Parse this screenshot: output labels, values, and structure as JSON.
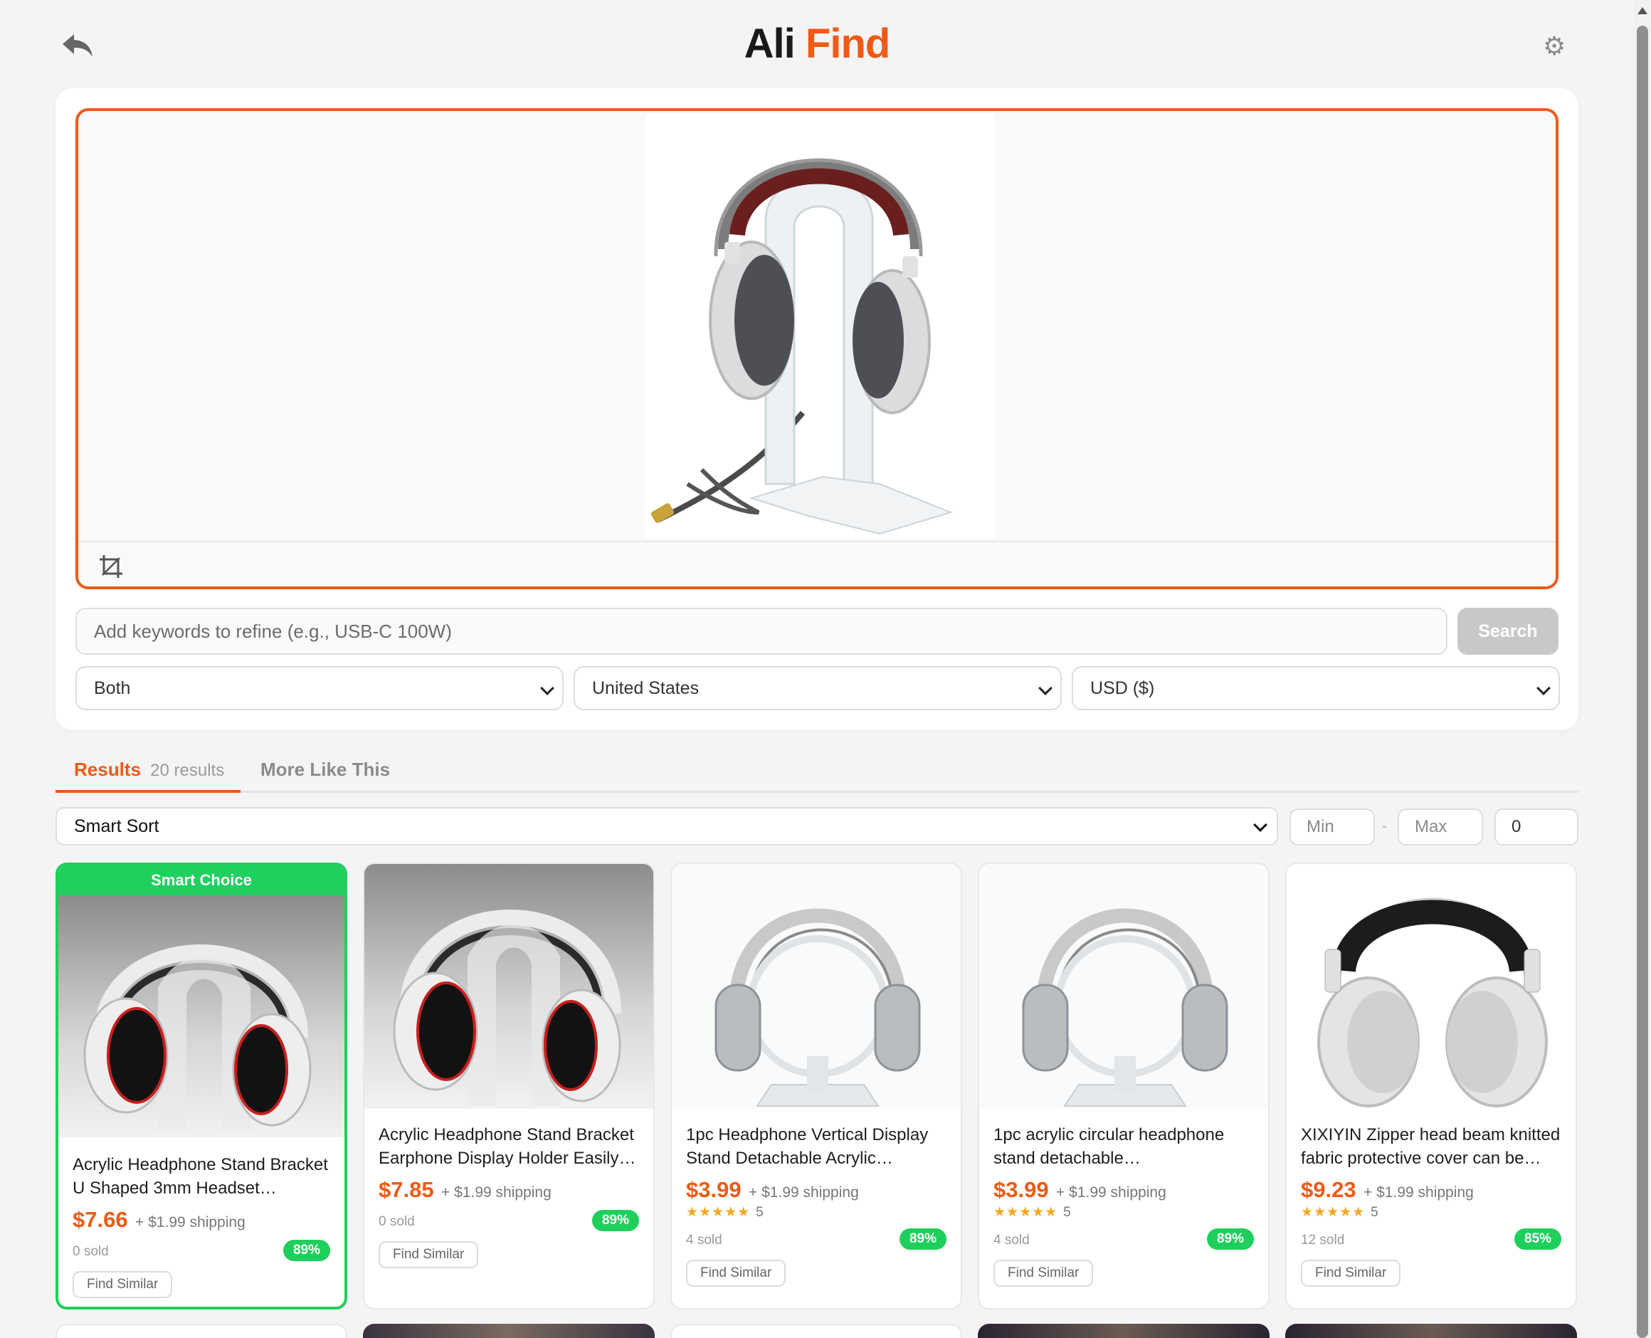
{
  "header": {
    "title_part1": "Ali",
    "title_part2": "Find",
    "settings_glyph": "⚙"
  },
  "search": {
    "placeholder": "Add keywords to refine (e.g., USB-C 100W)",
    "button_label": "Search",
    "select_type": "Both",
    "select_country": "United States",
    "select_currency": "USD ($)"
  },
  "tabs": {
    "results_label": "Results",
    "results_count": "20 results",
    "more_label": "More Like This"
  },
  "filters": {
    "sort_label": "Smart Sort",
    "min_placeholder": "Min",
    "dash": "-",
    "max_placeholder": "Max",
    "third_value": "0"
  },
  "products": [
    {
      "badge": "Smart Choice",
      "title": "Acrylic Headphone Stand Bracket U Shaped 3mm Headset…",
      "price": "$7.66",
      "shipping": "+ $1.99 shipping",
      "stars": "",
      "rating_count": "",
      "sold": "0 sold",
      "match": "89%",
      "find_similar": "Find Similar"
    },
    {
      "badge": "",
      "title": "Acrylic Headphone Stand Bracket Earphone Display Holder Easily…",
      "price": "$7.85",
      "shipping": "+ $1.99 shipping",
      "stars": "",
      "rating_count": "",
      "sold": "0 sold",
      "match": "89%",
      "find_similar": "Find Similar"
    },
    {
      "badge": "",
      "title": "1pc Headphone Vertical Display Stand Detachable Acrylic…",
      "price": "$3.99",
      "shipping": "+ $1.99 shipping",
      "stars": "★★★★★",
      "rating_count": "5",
      "sold": "4 sold",
      "match": "89%",
      "find_similar": "Find Similar"
    },
    {
      "badge": "",
      "title": "1pc acrylic circular headphone stand detachable…",
      "price": "$3.99",
      "shipping": "+ $1.99 shipping",
      "stars": "★★★★★",
      "rating_count": "5",
      "sold": "4 sold",
      "match": "89%",
      "find_similar": "Find Similar"
    },
    {
      "badge": "",
      "title": "XIXIYIN Zipper head beam knitted fabric protective cover can be…",
      "price": "$9.23",
      "shipping": "+ $1.99 shipping",
      "stars": "★★★★★",
      "rating_count": "5",
      "sold": "12 sold",
      "match": "85%",
      "find_similar": "Find Similar"
    }
  ],
  "colors": {
    "brand_orange": "#ee5a14",
    "match_green": "#1fcf5c",
    "star_gold": "#f5a623"
  },
  "icons": {
    "back": "back-arrow-icon",
    "settings": "gear-icon",
    "crop": "crop-icon",
    "chevron": "chevron-down-icon"
  }
}
